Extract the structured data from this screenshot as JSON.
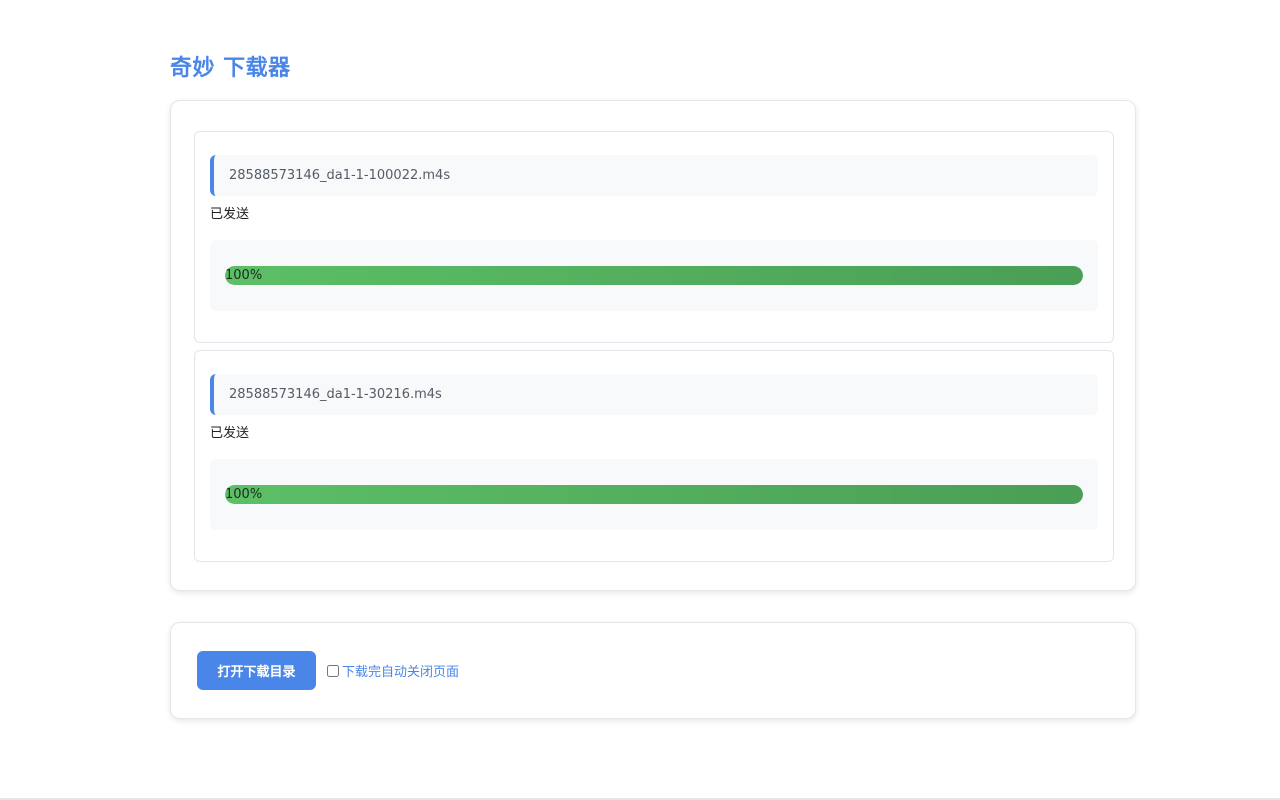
{
  "app": {
    "title": "奇妙 下载器"
  },
  "downloads": [
    {
      "filename": "28588573146_da1-1-100022.m4s",
      "status": "已发送",
      "progress_label": "100%",
      "progress_fraction": 1.0
    },
    {
      "filename": "28588573146_da1-1-30216.m4s",
      "status": "已发送",
      "progress_label": "100%",
      "progress_fraction": 1.0
    }
  ],
  "actions": {
    "open_dir_label": "打开下载目录",
    "auto_close_label": "下载完自动关闭页面",
    "auto_close_checked": false
  },
  "colors": {
    "accent": "#4a86e8",
    "progress_start": "#5cbf66",
    "progress_end": "#4a9e55"
  }
}
